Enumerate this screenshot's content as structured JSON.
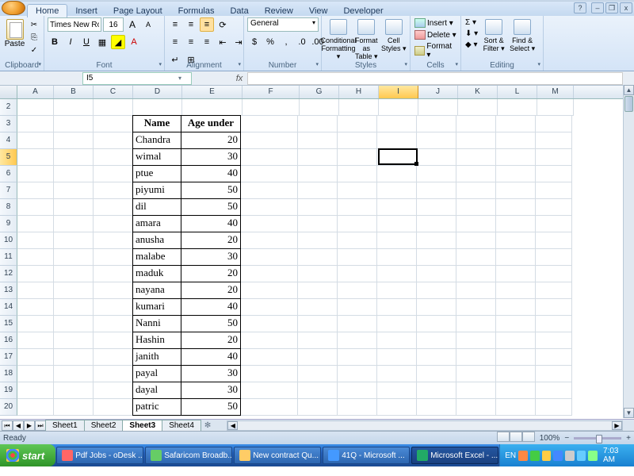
{
  "tabs": [
    "Home",
    "Insert",
    "Page Layout",
    "Formulas",
    "Data",
    "Review",
    "View",
    "Developer"
  ],
  "active_tab": 0,
  "window_ctrls": {
    "min": "–",
    "restore": "❐",
    "close": "x",
    "help": "?"
  },
  "ribbon": {
    "clipboard": {
      "label": "Clipboard",
      "paste": "Paste"
    },
    "font": {
      "label": "Font",
      "name": "Times New Rom",
      "size": "16",
      "btns": {
        "grow": "A",
        "shrink": "A",
        "bold": "B",
        "italic": "I",
        "underline": "U"
      }
    },
    "alignment": {
      "label": "Alignment"
    },
    "number": {
      "label": "Number",
      "format": "General",
      "btns": {
        "currency": "$",
        "percent": "%",
        "comma": ",",
        "inc": "←0",
        "dec": "0→"
      }
    },
    "styles": {
      "label": "Styles",
      "cond": "Conditional Formatting ▾",
      "table": "Format as Table ▾",
      "cell": "Cell Styles ▾"
    },
    "cells": {
      "label": "Cells",
      "insert": "Insert ▾",
      "delete": "Delete ▾",
      "format": "Format ▾"
    },
    "editing": {
      "label": "Editing",
      "sigma": "Σ ▾",
      "fill": "⬇ ▾",
      "clear": "◆ ▾",
      "sort": "Sort & Filter ▾",
      "find": "Find & Select ▾"
    }
  },
  "name_box": "I5",
  "fx": "fx",
  "columns": [
    "A",
    "B",
    "C",
    "D",
    "E",
    "F",
    "G",
    "H",
    "I",
    "J",
    "K",
    "L",
    "M"
  ],
  "selected_col": "I",
  "selected_row": 5,
  "row_start": 2,
  "row_end": 20,
  "table": {
    "headers": [
      "Name",
      "Age under"
    ],
    "rows": [
      [
        "Chandra",
        "20"
      ],
      [
        "wimal",
        "30"
      ],
      [
        "ptue",
        "40"
      ],
      [
        "piyumi",
        "50"
      ],
      [
        "dil",
        "50"
      ],
      [
        "amara",
        "40"
      ],
      [
        "anusha",
        "20"
      ],
      [
        "malabe",
        "30"
      ],
      [
        "maduk",
        "20"
      ],
      [
        "nayana",
        "20"
      ],
      [
        "kumari",
        "40"
      ],
      [
        "Nanni",
        "50"
      ],
      [
        "Hashin",
        "20"
      ],
      [
        "janith",
        "40"
      ],
      [
        "payal",
        "30"
      ],
      [
        "dayal",
        "30"
      ],
      [
        "patric",
        "50"
      ]
    ]
  },
  "sheets": [
    "Sheet1",
    "Sheet2",
    "Sheet3",
    "Sheet4"
  ],
  "active_sheet": 2,
  "sheet_nav": [
    "⏮",
    "◀",
    "▶",
    "⏭"
  ],
  "status": "Ready",
  "zoom": "100%",
  "zoom_btns": {
    "out": "−",
    "in": "+"
  },
  "taskbar": {
    "start": "start",
    "items": [
      {
        "label": "Pdf Jobs - oDesk ...",
        "color": "#f66"
      },
      {
        "label": "Safaricom Broadb...",
        "color": "#6c6"
      },
      {
        "label": "New contract Qu...",
        "color": "#fc6"
      },
      {
        "label": "41Q - Microsoft ...",
        "color": "#49f"
      },
      {
        "label": "Microsoft Excel - ...",
        "color": "#2a6",
        "active": true
      }
    ],
    "lang": "EN",
    "clock": "7:03 AM"
  }
}
